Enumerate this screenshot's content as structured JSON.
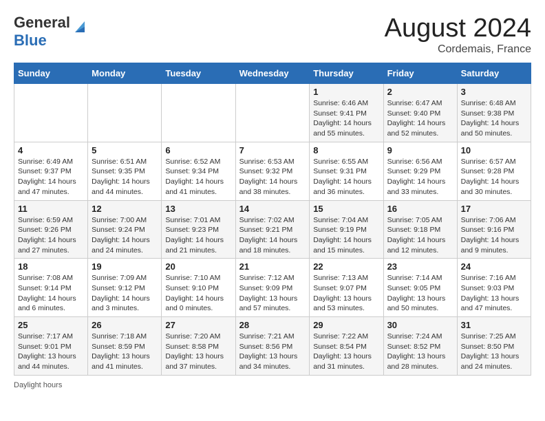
{
  "header": {
    "logo_line1": "General",
    "logo_line2": "Blue",
    "month_year": "August 2024",
    "location": "Cordemais, France"
  },
  "days_of_week": [
    "Sunday",
    "Monday",
    "Tuesday",
    "Wednesday",
    "Thursday",
    "Friday",
    "Saturday"
  ],
  "weeks": [
    [
      {
        "day": "",
        "info": ""
      },
      {
        "day": "",
        "info": ""
      },
      {
        "day": "",
        "info": ""
      },
      {
        "day": "",
        "info": ""
      },
      {
        "day": "1",
        "info": "Sunrise: 6:46 AM\nSunset: 9:41 PM\nDaylight: 14 hours\nand 55 minutes."
      },
      {
        "day": "2",
        "info": "Sunrise: 6:47 AM\nSunset: 9:40 PM\nDaylight: 14 hours\nand 52 minutes."
      },
      {
        "day": "3",
        "info": "Sunrise: 6:48 AM\nSunset: 9:38 PM\nDaylight: 14 hours\nand 50 minutes."
      }
    ],
    [
      {
        "day": "4",
        "info": "Sunrise: 6:49 AM\nSunset: 9:37 PM\nDaylight: 14 hours\nand 47 minutes."
      },
      {
        "day": "5",
        "info": "Sunrise: 6:51 AM\nSunset: 9:35 PM\nDaylight: 14 hours\nand 44 minutes."
      },
      {
        "day": "6",
        "info": "Sunrise: 6:52 AM\nSunset: 9:34 PM\nDaylight: 14 hours\nand 41 minutes."
      },
      {
        "day": "7",
        "info": "Sunrise: 6:53 AM\nSunset: 9:32 PM\nDaylight: 14 hours\nand 38 minutes."
      },
      {
        "day": "8",
        "info": "Sunrise: 6:55 AM\nSunset: 9:31 PM\nDaylight: 14 hours\nand 36 minutes."
      },
      {
        "day": "9",
        "info": "Sunrise: 6:56 AM\nSunset: 9:29 PM\nDaylight: 14 hours\nand 33 minutes."
      },
      {
        "day": "10",
        "info": "Sunrise: 6:57 AM\nSunset: 9:28 PM\nDaylight: 14 hours\nand 30 minutes."
      }
    ],
    [
      {
        "day": "11",
        "info": "Sunrise: 6:59 AM\nSunset: 9:26 PM\nDaylight: 14 hours\nand 27 minutes."
      },
      {
        "day": "12",
        "info": "Sunrise: 7:00 AM\nSunset: 9:24 PM\nDaylight: 14 hours\nand 24 minutes."
      },
      {
        "day": "13",
        "info": "Sunrise: 7:01 AM\nSunset: 9:23 PM\nDaylight: 14 hours\nand 21 minutes."
      },
      {
        "day": "14",
        "info": "Sunrise: 7:02 AM\nSunset: 9:21 PM\nDaylight: 14 hours\nand 18 minutes."
      },
      {
        "day": "15",
        "info": "Sunrise: 7:04 AM\nSunset: 9:19 PM\nDaylight: 14 hours\nand 15 minutes."
      },
      {
        "day": "16",
        "info": "Sunrise: 7:05 AM\nSunset: 9:18 PM\nDaylight: 14 hours\nand 12 minutes."
      },
      {
        "day": "17",
        "info": "Sunrise: 7:06 AM\nSunset: 9:16 PM\nDaylight: 14 hours\nand 9 minutes."
      }
    ],
    [
      {
        "day": "18",
        "info": "Sunrise: 7:08 AM\nSunset: 9:14 PM\nDaylight: 14 hours\nand 6 minutes."
      },
      {
        "day": "19",
        "info": "Sunrise: 7:09 AM\nSunset: 9:12 PM\nDaylight: 14 hours\nand 3 minutes."
      },
      {
        "day": "20",
        "info": "Sunrise: 7:10 AM\nSunset: 9:10 PM\nDaylight: 14 hours\nand 0 minutes."
      },
      {
        "day": "21",
        "info": "Sunrise: 7:12 AM\nSunset: 9:09 PM\nDaylight: 13 hours\nand 57 minutes."
      },
      {
        "day": "22",
        "info": "Sunrise: 7:13 AM\nSunset: 9:07 PM\nDaylight: 13 hours\nand 53 minutes."
      },
      {
        "day": "23",
        "info": "Sunrise: 7:14 AM\nSunset: 9:05 PM\nDaylight: 13 hours\nand 50 minutes."
      },
      {
        "day": "24",
        "info": "Sunrise: 7:16 AM\nSunset: 9:03 PM\nDaylight: 13 hours\nand 47 minutes."
      }
    ],
    [
      {
        "day": "25",
        "info": "Sunrise: 7:17 AM\nSunset: 9:01 PM\nDaylight: 13 hours\nand 44 minutes."
      },
      {
        "day": "26",
        "info": "Sunrise: 7:18 AM\nSunset: 8:59 PM\nDaylight: 13 hours\nand 41 minutes."
      },
      {
        "day": "27",
        "info": "Sunrise: 7:20 AM\nSunset: 8:58 PM\nDaylight: 13 hours\nand 37 minutes."
      },
      {
        "day": "28",
        "info": "Sunrise: 7:21 AM\nSunset: 8:56 PM\nDaylight: 13 hours\nand 34 minutes."
      },
      {
        "day": "29",
        "info": "Sunrise: 7:22 AM\nSunset: 8:54 PM\nDaylight: 13 hours\nand 31 minutes."
      },
      {
        "day": "30",
        "info": "Sunrise: 7:24 AM\nSunset: 8:52 PM\nDaylight: 13 hours\nand 28 minutes."
      },
      {
        "day": "31",
        "info": "Sunrise: 7:25 AM\nSunset: 8:50 PM\nDaylight: 13 hours\nand 24 minutes."
      }
    ]
  ],
  "footer": {
    "daylight_label": "Daylight hours"
  }
}
